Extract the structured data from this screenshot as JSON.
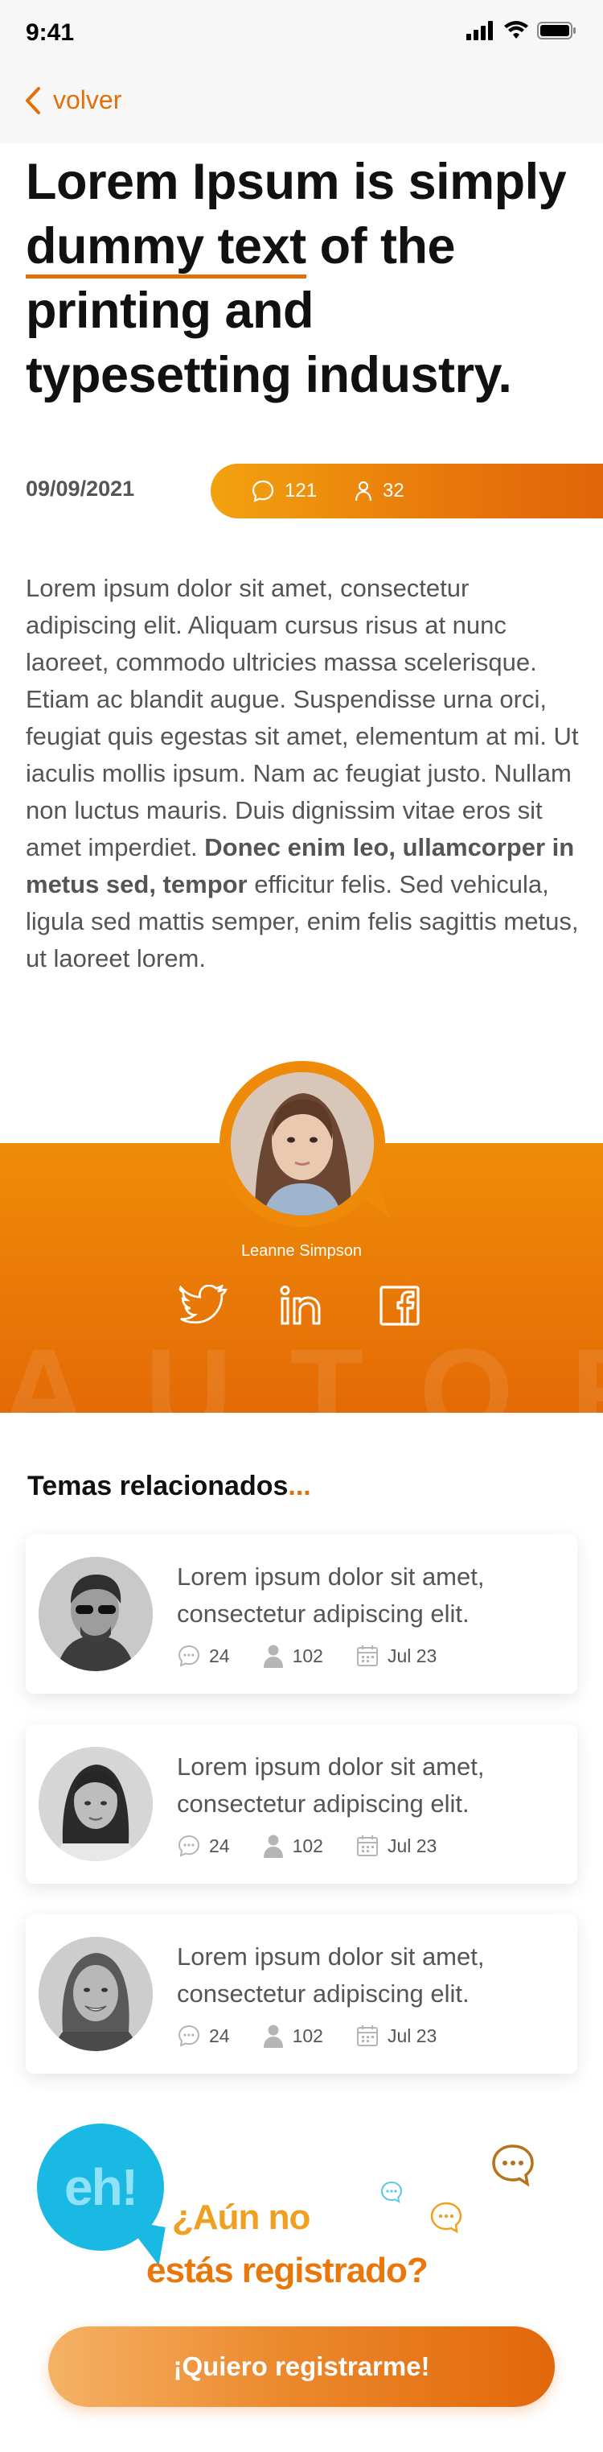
{
  "status_bar": {
    "time": "9:41"
  },
  "nav": {
    "back_label": "volver"
  },
  "article": {
    "title_part1": "Lorem Ipsum is simply ",
    "title_highlight": "dummy text",
    "title_part2": " of the printing and typesetting industry.",
    "date": "09/09/2021",
    "comments": "121",
    "readers": "32",
    "body_part1": "Lorem ipsum dolor sit amet, consectetur adipiscing elit. Aliquam cursus risus at nunc laoreet, commodo ultricies massa scelerisque. Etiam ac blandit augue. Suspendisse urna orci, feugiat quis egestas sit amet, elementum at mi. Ut iaculis mollis ipsum. Nam ac feugiat justo. Nullam non luctus mauris. Duis dignissim vitae eros sit amet imperdiet. ",
    "body_bold": "Donec enim leo, ullamcorper in metus sed, tempor",
    "body_part2": " efficitur felis. Sed vehicula, ligula sed mattis semper, enim felis sagittis metus, ut laoreet lorem."
  },
  "author": {
    "name": "Leanne Simpson",
    "watermark": "AUTOR",
    "socials": [
      "twitter-icon",
      "linkedin-icon",
      "facebook-icon"
    ]
  },
  "related": {
    "title": "Temas relacionados",
    "title_suffix": "...",
    "items": [
      {
        "text": "Lorem ipsum dolor sit amet, consectetur adipiscing elit.",
        "comments": "24",
        "readers": "102",
        "date": "Jul 23"
      },
      {
        "text": "Lorem ipsum dolor sit amet, consectetur adipiscing elit.",
        "comments": "24",
        "readers": "102",
        "date": "Jul 23"
      },
      {
        "text": "Lorem ipsum dolor sit amet, consectetur adipiscing elit.",
        "comments": "24",
        "readers": "102",
        "date": "Jul 23"
      }
    ]
  },
  "register": {
    "logo_text": "eh!",
    "line1": "¿Aún no",
    "line2": "estás registrado?",
    "cta_label": "¡Quiero registrarme!"
  },
  "colors": {
    "accent": "#e36f0b",
    "accent_light": "#f3a20f",
    "logo_blue": "#1ab9e4",
    "text_gray": "#555555"
  }
}
